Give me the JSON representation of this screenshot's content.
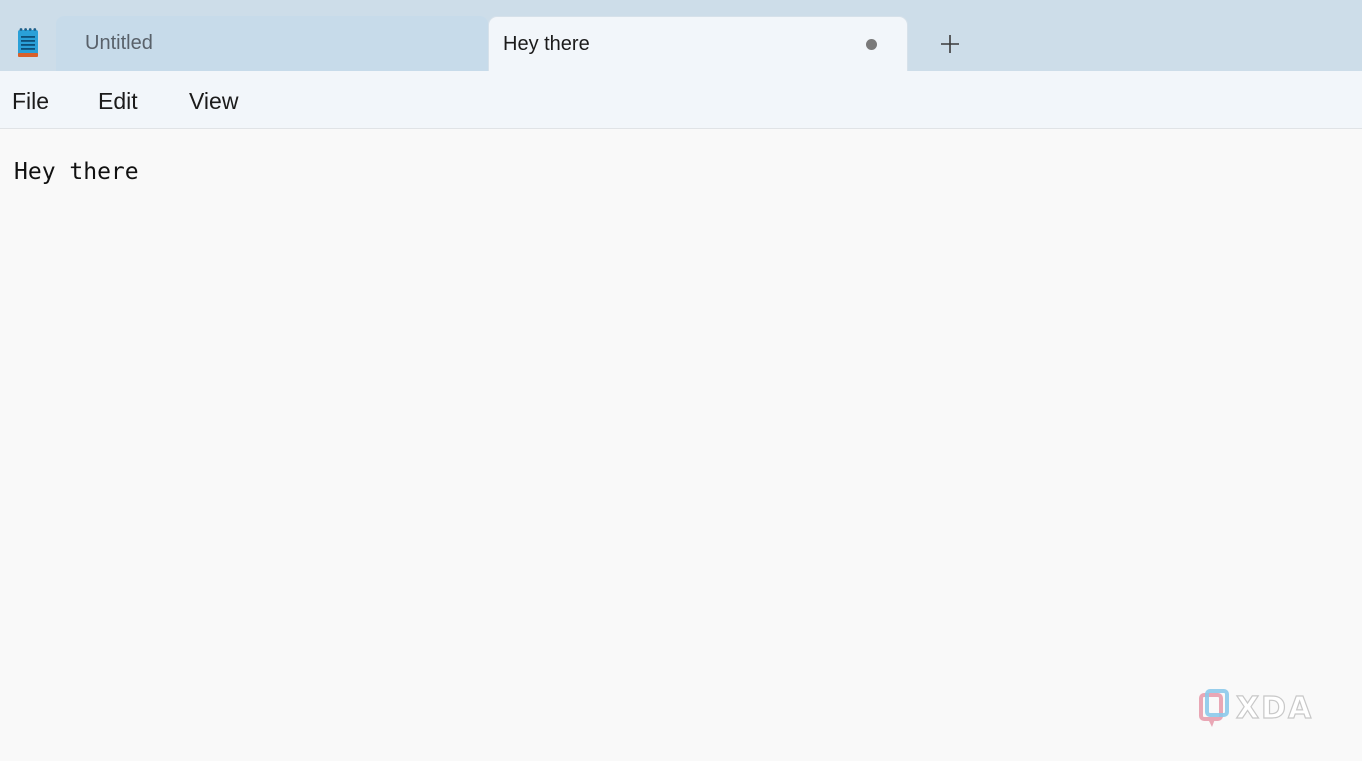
{
  "app": {
    "icon": "notepad-icon"
  },
  "tabs": [
    {
      "label": "Untitled",
      "active": false
    },
    {
      "label": "Hey there",
      "active": true,
      "unsaved": true
    }
  ],
  "new_tab_icon": "plus-icon",
  "menu": {
    "file": "File",
    "edit": "Edit",
    "view": "View"
  },
  "editor": {
    "content": "Hey there"
  },
  "watermark": {
    "text": "XDA"
  },
  "colors": {
    "tabbar_bg": "#cddde9",
    "active_tab_bg": "#f2f6fa",
    "editor_bg": "#f9f9f9",
    "icon_blue": "#2aa0d8",
    "icon_orange": "#d9602a"
  }
}
